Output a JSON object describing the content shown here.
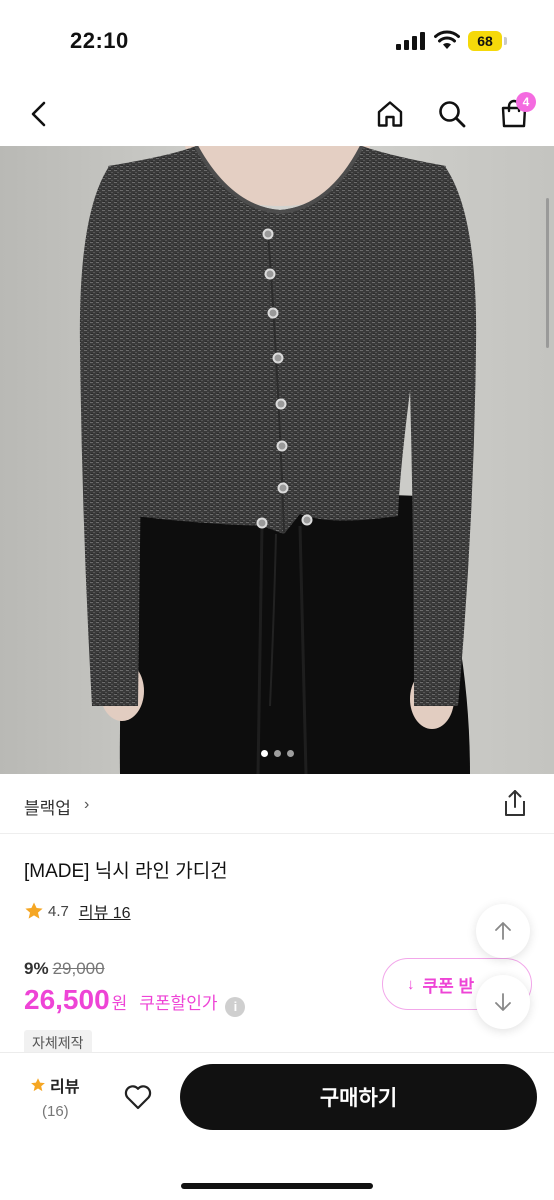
{
  "status_bar": {
    "time": "22:10",
    "battery": "68"
  },
  "nav": {
    "back_icon": "chevron-left-icon",
    "home_icon": "home-icon",
    "search_icon": "search-icon",
    "cart_icon": "shopping-bag-icon",
    "cart_badge": "4"
  },
  "hero": {
    "image_count": 3,
    "active_index": 0
  },
  "brand": {
    "name": "블랙업",
    "chevron": "›",
    "share_icon": "share-icon"
  },
  "product": {
    "title": "[MADE] 닉시 라인 가디건",
    "rating": "4.7",
    "review_link": "리뷰 16",
    "discount_rate": "9%",
    "original_price": "29,000",
    "sale_price": "26,500",
    "currency": "원",
    "coupon_discount_label": "쿠폰할인가",
    "info_icon": "i",
    "tag": "자체제작"
  },
  "coupon_button": {
    "icon": "↓",
    "label": "쿠폰 받"
  },
  "floating": {
    "up_icon": "arrow-up-icon",
    "down_icon": "arrow-down-icon"
  },
  "bottom_bar": {
    "review_label": "리뷰",
    "review_count": "(16)",
    "buy_label": "구매하기"
  },
  "colors": {
    "accent": "#ee44d6",
    "badge": "#f46be0",
    "star": "#f5a623",
    "buy_button": "#111111"
  }
}
